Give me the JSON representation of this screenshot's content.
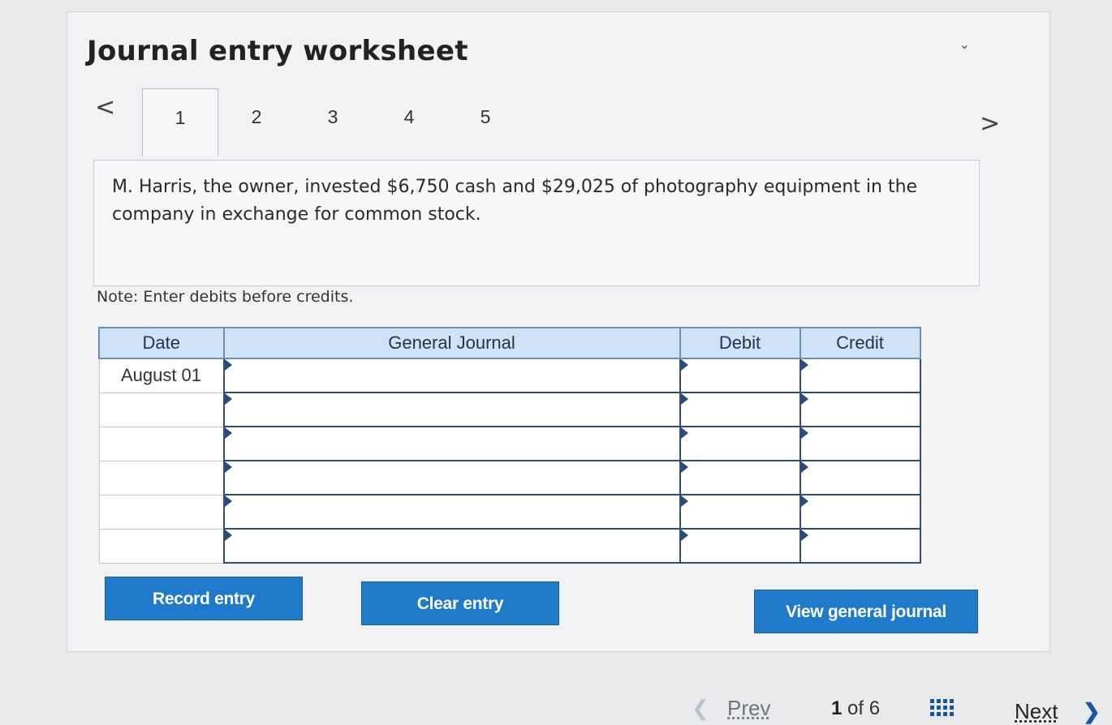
{
  "worksheet": {
    "title": "Journal entry worksheet",
    "tabs": [
      "1",
      "2",
      "3",
      "4",
      "5"
    ],
    "active_tab": "1",
    "prev_tab_glyph": "<",
    "next_tab_glyph": ">",
    "question": "M. Harris, the owner, invested $6,750 cash and $29,025 of photography equipment in the company in exchange for common stock.",
    "note": "Note: Enter debits before credits."
  },
  "journal": {
    "headers": {
      "date": "Date",
      "general_journal": "General Journal",
      "debit": "Debit",
      "credit": "Credit"
    },
    "rows": [
      {
        "date": "August 01",
        "account": "",
        "debit": "",
        "credit": ""
      },
      {
        "date": "",
        "account": "",
        "debit": "",
        "credit": ""
      },
      {
        "date": "",
        "account": "",
        "debit": "",
        "credit": ""
      },
      {
        "date": "",
        "account": "",
        "debit": "",
        "credit": ""
      },
      {
        "date": "",
        "account": "",
        "debit": "",
        "credit": ""
      },
      {
        "date": "",
        "account": "",
        "debit": "",
        "credit": ""
      }
    ]
  },
  "buttons": {
    "record": "Record entry",
    "clear": "Clear entry",
    "view": "View general journal"
  },
  "footer": {
    "prev": "Prev",
    "current_page": "1",
    "of_label": "of",
    "total_pages": "6",
    "next": "Next"
  },
  "colors": {
    "button_blue": "#1f7bc9",
    "header_blue": "#cfe3f7",
    "border_navy": "#2f4f79"
  }
}
